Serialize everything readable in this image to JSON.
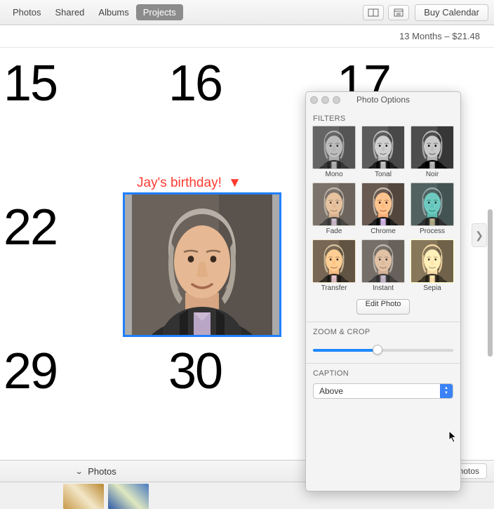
{
  "toolbar": {
    "tabs": [
      "Photos",
      "Shared",
      "Albums",
      "Projects"
    ],
    "active_tab_index": 3,
    "buy_label": "Buy Calendar"
  },
  "substatus": "13 Months – $21.48",
  "days": {
    "d15": "15",
    "d16": "16",
    "d17": "17",
    "d22": "22",
    "d29": "29",
    "d30": "30"
  },
  "photo": {
    "caption_text": "Jay's birthday!",
    "caption_indicator": "▼"
  },
  "footer": {
    "section_label": "Photos",
    "right_button_label": "notos"
  },
  "panel": {
    "title": "Photo Options",
    "filters_label": "FILTERS",
    "filters": [
      {
        "name": "Mono",
        "cls": "ft-mono"
      },
      {
        "name": "Tonal",
        "cls": "ft-tonal"
      },
      {
        "name": "Noir",
        "cls": "ft-noir"
      },
      {
        "name": "Fade",
        "cls": "ft-fade"
      },
      {
        "name": "Chrome",
        "cls": "ft-chrome"
      },
      {
        "name": "Process",
        "cls": "ft-process"
      },
      {
        "name": "Transfer",
        "cls": "ft-transfer"
      },
      {
        "name": "Instant",
        "cls": "ft-instant"
      },
      {
        "name": "Sepia",
        "cls": "ft-sepia"
      }
    ],
    "edit_btn": "Edit Photo",
    "zoom_label": "ZOOM & CROP",
    "caption_label": "CAPTION",
    "caption_value": "Above"
  }
}
